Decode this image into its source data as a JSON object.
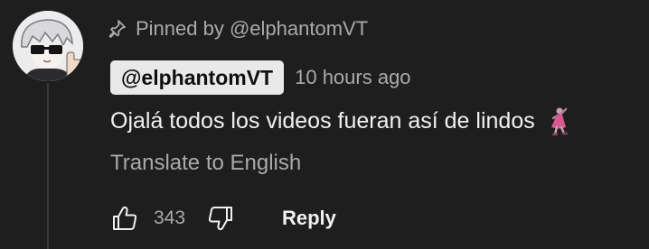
{
  "comment": {
    "pinned_text": "Pinned by @elphantomVT",
    "author": "@elphantomVT",
    "timestamp": "10 hours ago",
    "text": "Ojalá todos los videos fueran así de lindos",
    "translate_label": "Translate to English",
    "like_count": "343",
    "reply_label": "Reply"
  },
  "icons": {
    "pin": "pin-icon",
    "like": "thumbs-up-icon",
    "dislike": "thumbs-down-icon",
    "emoji": "dancer-emoji-icon",
    "avatar": "avatar-sunglasses-character"
  },
  "colors": {
    "background": "#1f1e1f",
    "primary_text": "#f1f1f1",
    "secondary_text": "#aaaaaa",
    "author_chip_bg": "#e9e9e9"
  }
}
